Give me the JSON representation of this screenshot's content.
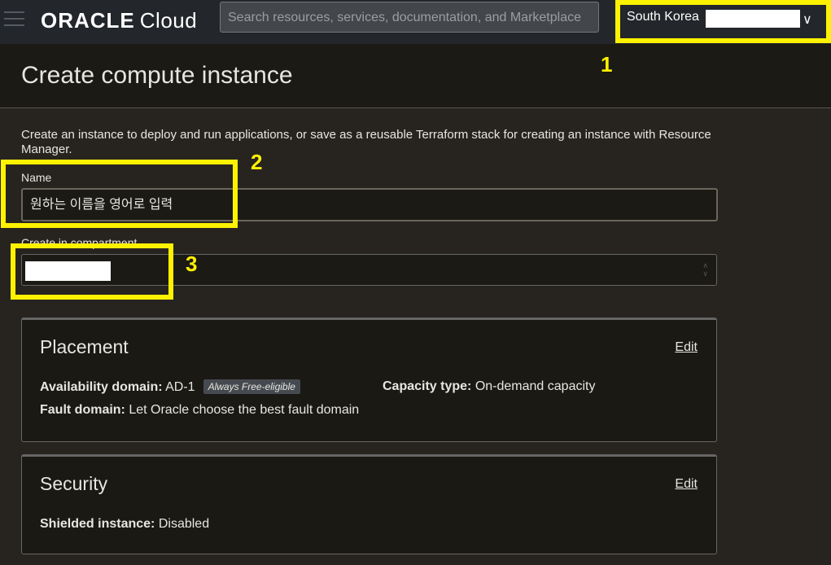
{
  "header": {
    "logo": {
      "brand": "ORACLE",
      "product": "Cloud"
    },
    "search_placeholder": "Search resources, services, documentation, and Marketplace",
    "region": "South Korea",
    "icons": {
      "menu": "hamburger-icon",
      "region_dropdown": "chevron-down-icon"
    }
  },
  "page": {
    "title": "Create compute instance",
    "description": "Create an instance to deploy and run applications, or save as a reusable Terraform stack for creating an instance with Resource Manager."
  },
  "form": {
    "name_label": "Name",
    "name_value": "원하는 이름을 영어로 입력",
    "compartment_label": "Create in compartment"
  },
  "placement": {
    "title": "Placement",
    "edit": "Edit",
    "availability_domain_label": "Availability domain:",
    "availability_domain_value": "AD-1",
    "badge": "Always Free-eligible",
    "capacity_type_label": "Capacity type:",
    "capacity_type_value": "On-demand capacity",
    "fault_domain_label": "Fault domain:",
    "fault_domain_value": "Let Oracle choose the best fault domain"
  },
  "security": {
    "title": "Security",
    "edit": "Edit",
    "shielded_label": "Shielded instance:",
    "shielded_value": "Disabled"
  },
  "annotations": {
    "one": "1",
    "two": "2",
    "three": "3",
    "color": "#fff200"
  }
}
